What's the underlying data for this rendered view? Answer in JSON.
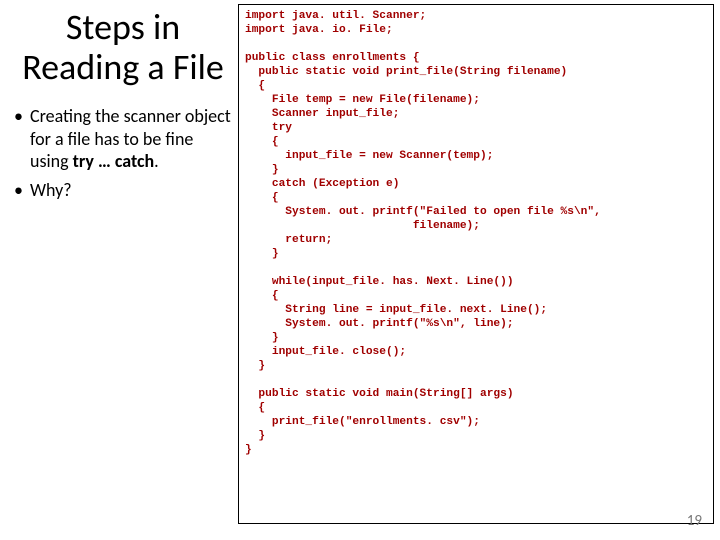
{
  "title": "Steps in Reading a File",
  "bullets": [
    {
      "pre": "Creating the scanner object for a file has to be fine using ",
      "bold": "try … catch",
      "post": "."
    },
    {
      "pre": "Why?",
      "bold": "",
      "post": ""
    }
  ],
  "code": "import java. util. Scanner;\nimport java. io. File;\n\npublic class enrollments {\n  public static void print_file(String filename)\n  {\n    File temp = new File(filename);\n    Scanner input_file;\n    try\n    {\n      input_file = new Scanner(temp);\n    }\n    catch (Exception e)\n    {\n      System. out. printf(\"Failed to open file %s\\n\",\n                         filename);\n      return;\n    }\n\n    while(input_file. has. Next. Line())\n    {\n      String line = input_file. next. Line();\n      System. out. printf(\"%s\\n\", line);\n    }\n    input_file. close();\n  }\n\n  public static void main(String[] args)\n  {\n    print_file(\"enrollments. csv\");\n  }\n}",
  "page_number": "19"
}
